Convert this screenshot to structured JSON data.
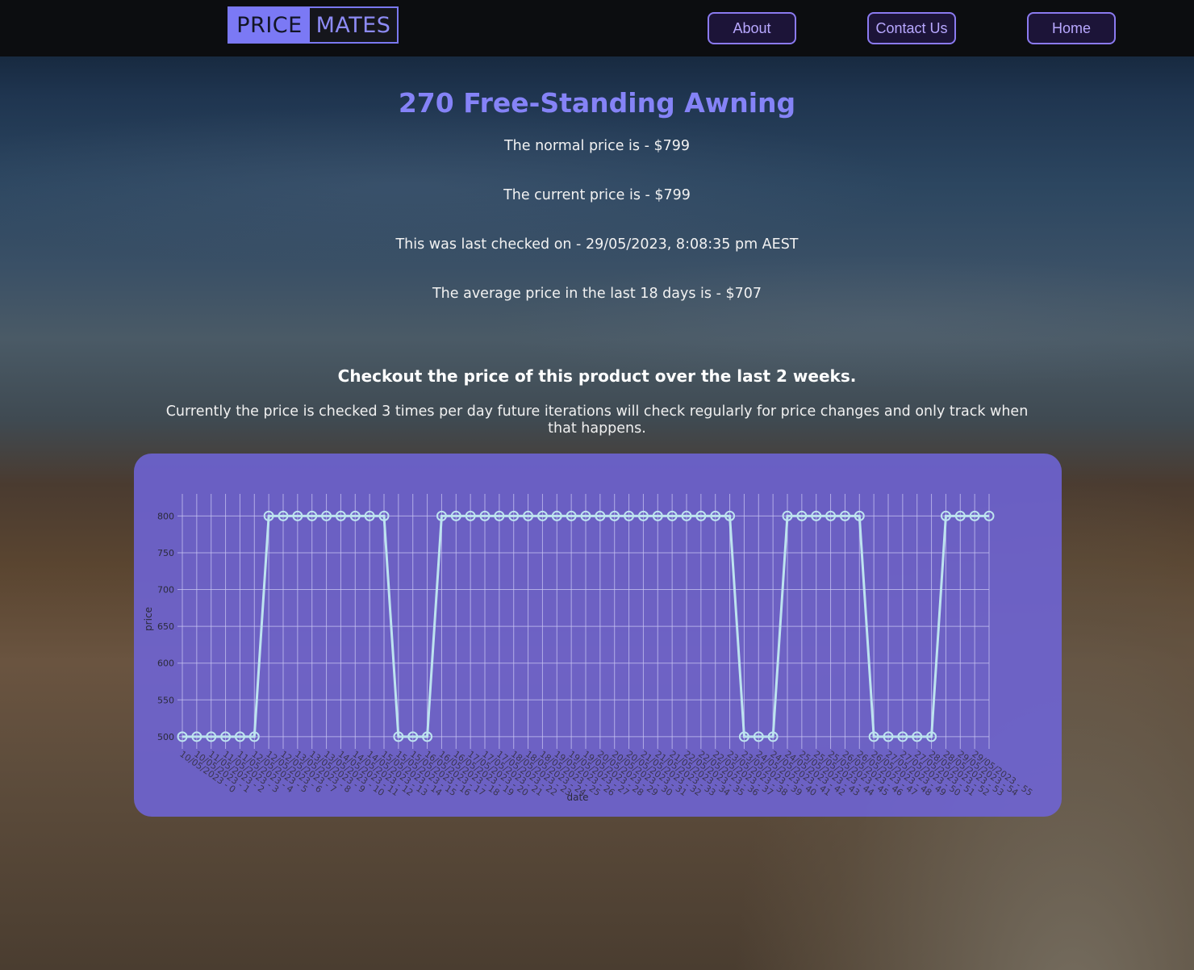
{
  "nav": {
    "logo_left": "PRICE",
    "logo_right": "MATES",
    "about": "About",
    "contact": "Contact Us",
    "home": "Home"
  },
  "product": {
    "title": "270 Free-Standing Awning",
    "normal_price": "The normal price is - $799",
    "current_price": "The current price is - $799",
    "last_checked": "This was last checked on - 29/05/2023, 8:08:35 pm AEST",
    "average_price": "The average price in the last 18 days is - $707"
  },
  "section": {
    "heading": "Checkout the price of this product over the last 2 weeks.",
    "note": "Currently the price is checked 3 times per day future iterations will check regularly for price changes and only track when that happens."
  },
  "colors": {
    "accent": "#8583f7",
    "panel": "#6e64d7",
    "line": "#bde3ef",
    "grid": "#c9c6f3"
  },
  "chart_data": {
    "type": "line",
    "title": "",
    "xlabel": "date",
    "ylabel": "price",
    "ylim": [
      490,
      830
    ],
    "yticks": [
      500,
      550,
      600,
      650,
      700,
      750,
      800
    ],
    "grid": true,
    "x": [
      "10/05/2023 - 0",
      "10/05/2023 - 1",
      "11/05/2023 - 2",
      "11/05/2023 - 3",
      "11/05/2023 - 4",
      "12/05/2023 - 5",
      "12/05/2023 - 6",
      "12/05/2023 - 7",
      "13/05/2023 - 8",
      "13/05/2023 - 9",
      "13/05/2023 - 10",
      "14/05/2023 - 11",
      "14/05/2023 - 12",
      "14/05/2023 - 13",
      "15/05/2023 - 14",
      "15/05/2023 - 15",
      "15/05/2023 - 16",
      "16/05/2023 - 17",
      "16/05/2023 - 18",
      "16/05/2023 - 19",
      "17/05/2023 - 20",
      "17/05/2023 - 21",
      "17/05/2023 - 22",
      "18/05/2023 - 23",
      "18/05/2023 - 24",
      "18/05/2023 - 25",
      "19/05/2023 - 26",
      "19/05/2023 - 27",
      "19/05/2023 - 28",
      "20/05/2023 - 29",
      "20/05/2023 - 30",
      "20/05/2023 - 31",
      "21/05/2023 - 32",
      "21/05/2023 - 33",
      "21/05/2023 - 34",
      "22/05/2023 - 35",
      "22/05/2023 - 36",
      "22/05/2023 - 37",
      "23/05/2023 - 38",
      "23/05/2023 - 39",
      "24/05/2023 - 40",
      "24/05/2023 - 41",
      "24/05/2023 - 42",
      "25/05/2023 - 43",
      "25/05/2023 - 44",
      "25/05/2023 - 45",
      "26/05/2023 - 46",
      "26/05/2023 - 47",
      "26/05/2023 - 48",
      "27/05/2023 - 49",
      "27/05/2023 - 50",
      "27/05/2023 - 51",
      "28/05/2023 - 52",
      "28/05/2023 - 53",
      "29/05/2023 - 54",
      "29/05/2023 - 55"
    ],
    "series": [
      {
        "values": [
          500,
          500,
          500,
          500,
          500,
          500,
          800,
          800,
          800,
          800,
          800,
          800,
          800,
          800,
          800,
          500,
          500,
          500,
          800,
          800,
          800,
          800,
          800,
          800,
          800,
          800,
          800,
          800,
          800,
          800,
          800,
          800,
          800,
          800,
          800,
          800,
          800,
          800,
          800,
          500,
          500,
          500,
          800,
          800,
          800,
          800,
          800,
          800,
          500,
          500,
          500,
          500,
          500,
          800,
          800,
          800,
          800
        ]
      }
    ]
  }
}
